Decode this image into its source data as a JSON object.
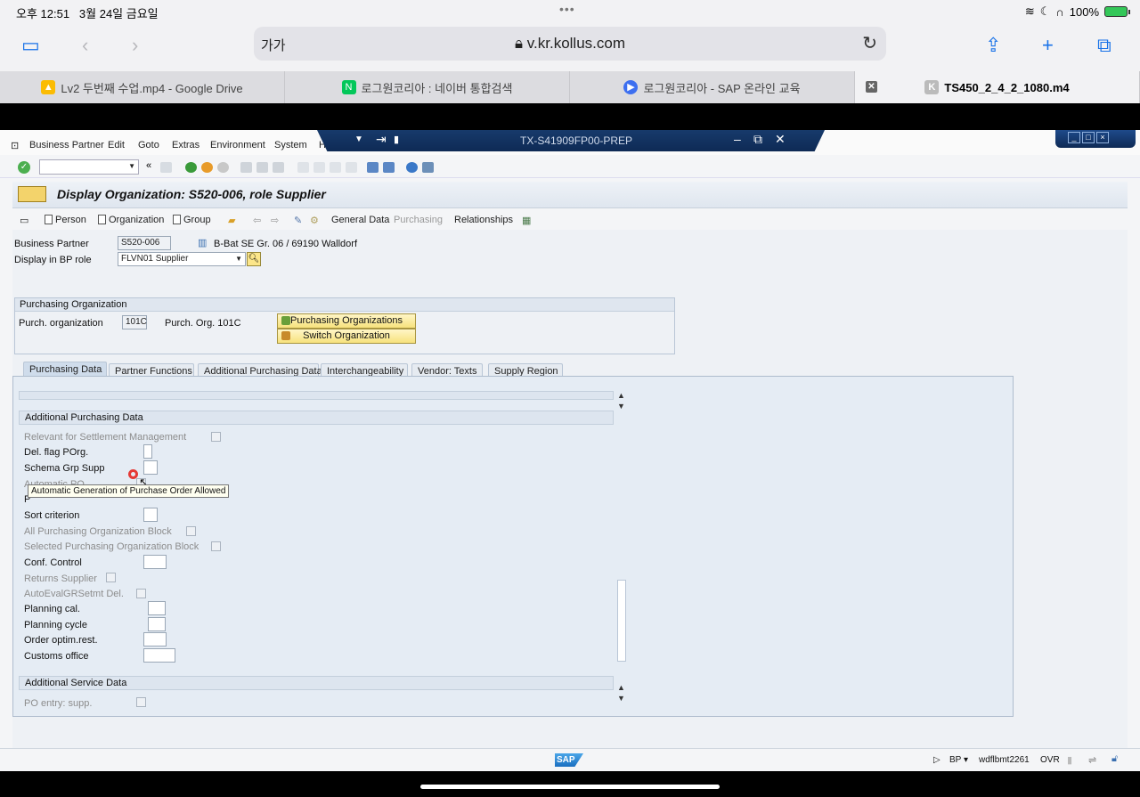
{
  "ios": {
    "time": "오후 12:51",
    "date": "3월 24일 금요일",
    "battery": "100%"
  },
  "browser": {
    "aa_label": "가가",
    "url": "v.kr.kollus.com",
    "tabs": [
      {
        "label": "Lv2 두번째 수업.mp4 - Google Drive",
        "icon": "google-drive-icon",
        "color": "#fbbc04"
      },
      {
        "label": "로그원코리아 : 네이버 통합검색",
        "icon": "naver-icon",
        "color": "#03c75a"
      },
      {
        "label": "로그원코리아 - SAP 온라인 교육",
        "icon": "play-icon",
        "color": "#3d6ff0"
      },
      {
        "label": "TS450_2_4_2_1080.m4",
        "icon": "kollus-icon",
        "color": "#bbbbbb"
      }
    ]
  },
  "sap": {
    "menu": {
      "business_partner": "Business Partner",
      "edit": "Edit",
      "goto": "Goto",
      "extras": "Extras",
      "environment": "Environment",
      "system": "System",
      "help": "H"
    },
    "window_title": "TX-S41909FP00-PREP",
    "page_title": "Display Organization: S520-006, role Supplier",
    "app_toolbar": {
      "person": "Person",
      "organization": "Organization",
      "group": "Group",
      "general_data": "General Data",
      "purchasing": "Purchasing",
      "relationships": "Relationships"
    },
    "header_fields": {
      "bp_label": "Business Partner",
      "bp_value": "S520-006",
      "bp_desc": "B-Bat SE Gr. 06 / 69190 Walldorf",
      "role_label": "Display in BP role",
      "role_value": "FLVN01 Supplier"
    },
    "purch_org_group": {
      "title": "Purchasing Organization",
      "label": "Purch. organization",
      "value": "101C",
      "desc": "Purch. Org. 101C",
      "btn_orgs": "Purchasing Organizations",
      "btn_switch": "Switch Organization"
    },
    "tabs": [
      "Purchasing Data",
      "Partner Functions",
      "Additional Purchasing Data",
      "Interchangeability",
      "Vendor: Texts",
      "Supply Region"
    ],
    "additional_purchasing": {
      "title": "Additional Purchasing Data",
      "rows": {
        "settlement": "Relevant for Settlement Management",
        "del_flag": "Del. flag POrg.",
        "schema_grp": "Schema Grp Supp",
        "auto_po": "Automatic PO",
        "row_p": "P",
        "sort_criterion": "Sort criterion",
        "all_po_block": "All Purchasing Organization Block",
        "sel_po_block": "Selected Purchasing Organization Block",
        "conf_control": "Conf. Control",
        "returns_supplier": "Returns Supplier",
        "auto_eval": "AutoEvalGRSetmt Del.",
        "planning_cal": "Planning cal.",
        "planning_cycle": "Planning cycle",
        "order_optim": "Order optim.rest.",
        "customs_office": "Customs office"
      }
    },
    "additional_service": {
      "title": "Additional Service Data",
      "po_entry": "PO entry: supp."
    },
    "tooltip": "Automatic Generation of Purchase Order Allowed",
    "status": {
      "tx": "BP",
      "server": "wdflbmt2261",
      "mode": "OVR"
    }
  }
}
